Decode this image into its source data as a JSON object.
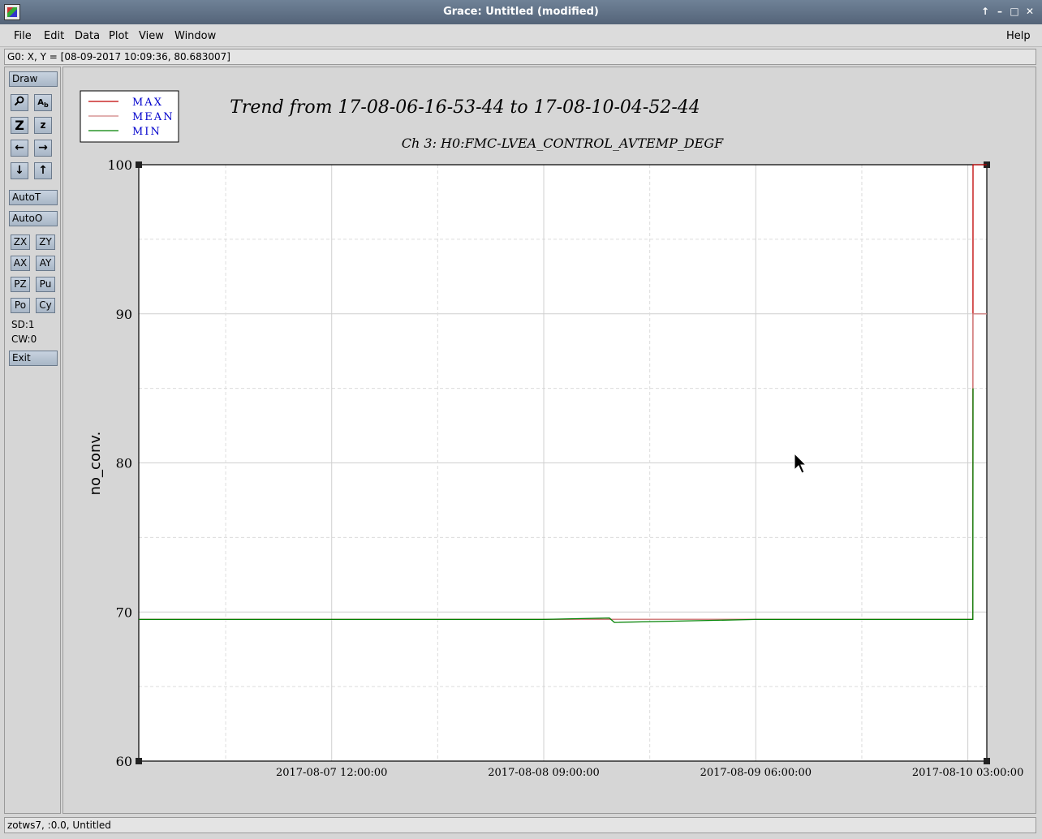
{
  "window": {
    "title": "Grace: Untitled (modified)",
    "controls": [
      "↑",
      "–",
      "□",
      "✕"
    ]
  },
  "menubar": {
    "items": [
      "File",
      "Edit",
      "Data",
      "Plot",
      "View",
      "Window"
    ],
    "help": "Help"
  },
  "location": "G0: X, Y = [08-09-2017 10:09:36, 80.683007]",
  "toolbar": {
    "draw": "Draw",
    "zoom_icon": "magnifier-icon",
    "autot": "AutoT",
    "autoo": "AutoO",
    "small_buttons": [
      "ZX",
      "ZY",
      "AX",
      "AY",
      "PZ",
      "Pu",
      "Po",
      "Cy"
    ],
    "sd": "SD:1",
    "cw": "CW:0",
    "exit": "Exit"
  },
  "status": "zotws7, :0.0, Untitled",
  "chart_data": {
    "type": "line",
    "title": "Trend from 17-08-06-16-53-44 to 17-08-10-04-52-44",
    "subtitle": "Ch 3: H0:FMC-LVEA_CONTROL_AVTEMP_DEGF",
    "ylabel": "no_conv.",
    "xlabel": "",
    "ylim": [
      60,
      100
    ],
    "yticks": [
      "100",
      "90",
      "80",
      "70",
      "60"
    ],
    "xticks": [
      "2017-08-07 12:00:00",
      "2017-08-08 09:00:00",
      "2017-08-09 06:00:00",
      "2017-08-10 03:00:00"
    ],
    "xlim": [
      "2017-08-06 16:53:44",
      "2017-08-10 04:52:44"
    ],
    "grid": true,
    "legend": "top-left",
    "series": [
      {
        "name": "MAX",
        "color": "#c00000",
        "x": [
          "2017-08-06 16:53:44",
          "2017-08-10 03:30:00",
          "2017-08-10 03:31:00",
          "2017-08-10 04:52:44"
        ],
        "values": [
          69.5,
          69.5,
          100,
          100
        ]
      },
      {
        "name": "MEAN",
        "color": "#d08080",
        "x": [
          "2017-08-06 16:53:44",
          "2017-08-10 03:30:00",
          "2017-08-10 03:31:00",
          "2017-08-10 04:52:44"
        ],
        "values": [
          69.5,
          69.5,
          90,
          90
        ]
      },
      {
        "name": "MIN",
        "color": "#008000",
        "x": [
          "2017-08-06 16:53:44",
          "2017-08-07 12:00:00",
          "2017-08-08 09:00:00",
          "2017-08-08 15:30:00",
          "2017-08-08 16:00:00",
          "2017-08-09 06:00:00",
          "2017-08-10 03:30:00",
          "2017-08-10 03:31:00"
        ],
        "values": [
          69.5,
          69.5,
          69.5,
          69.6,
          69.3,
          69.5,
          69.5,
          85
        ]
      }
    ]
  }
}
